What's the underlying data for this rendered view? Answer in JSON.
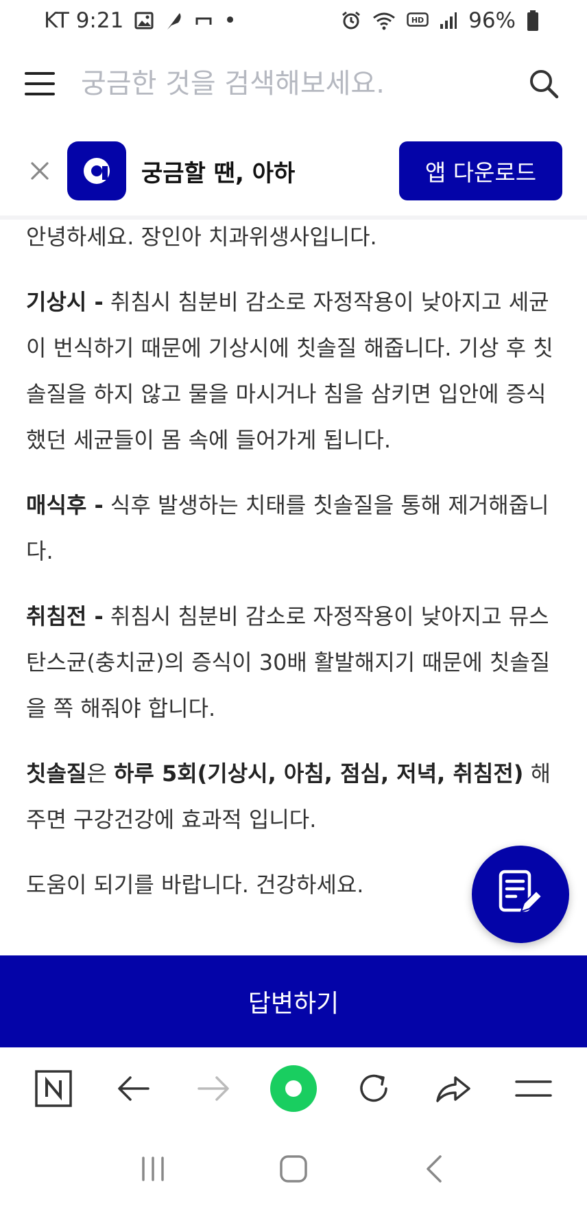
{
  "status_bar": {
    "carrier_time": "KT 9:21",
    "dot": "•",
    "battery": "96%"
  },
  "search": {
    "placeholder": "궁금한 것을 검색해보세요."
  },
  "app_banner": {
    "logo_letter": "a",
    "title": "궁금할 땐, 아하",
    "download_label": "앱 다운로드"
  },
  "answer": {
    "greeting": "안녕하세요. 장인아 치과위생사입니다.",
    "wake": {
      "label": "기상시 -",
      "text": " 취침시 침분비 감소로 자정작용이 낮아지고 세균이 번식하기 때문에 기상시에 칫솔질 해줍니다. 기상 후 칫솔질을 하지 않고 물을 마시거나 침을 삼키면 입안에 증식했던 세균들이 몸 속에 들어가게 됩니다."
    },
    "meal": {
      "label": "매식후 -",
      "text": " 식후 발생하는 치태를 칫솔질을 통해 제거해줍니다."
    },
    "bed": {
      "label": "취침전 -",
      "text": " 취침시 침분비 감소로 자정작용이 낮아지고 뮤스탄스균(충치균)의 증식이 30배 활발해지기 때문에 칫솔질을 쪽 해줘야 합니다."
    },
    "summary": {
      "part1_bold": "칫솔질",
      "part2": "은 ",
      "part3_bold": "하루 5회(기상시, 아침, 점심, 저녁, 취침전)",
      "part4": " 해주면 구강건강에 효과적 입니다."
    },
    "closing": "도움이 되기를 바랍니다. 건강하세요."
  },
  "answer_button": {
    "label": "답변하기"
  },
  "colors": {
    "brand": "#0404a8",
    "naver_green": "#19ce60"
  },
  "icons": {
    "toolbar": [
      "naver-n-icon",
      "back-arrow-icon",
      "forward-arrow-icon",
      "green-dot-icon",
      "refresh-icon",
      "share-icon",
      "menu-icon"
    ],
    "system_nav": [
      "recents-icon",
      "home-icon",
      "back-icon"
    ]
  }
}
